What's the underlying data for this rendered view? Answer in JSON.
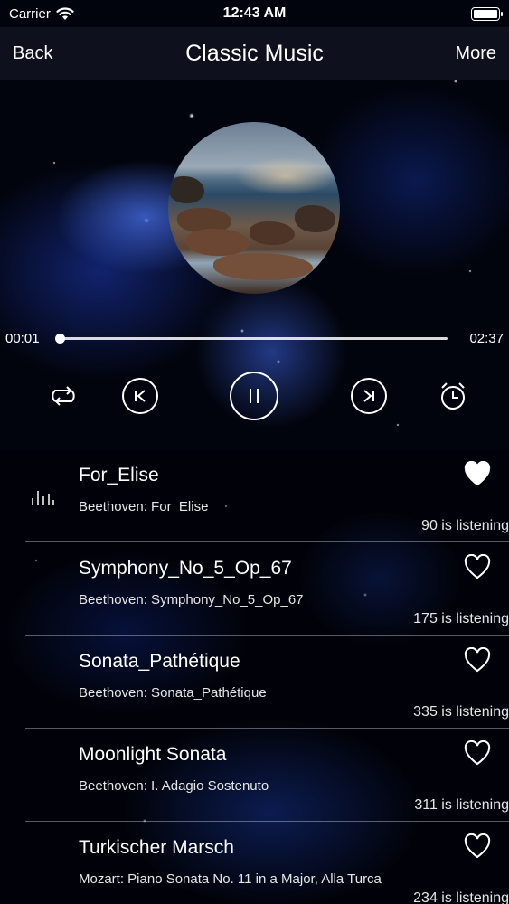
{
  "status_bar": {
    "carrier": "Carrier",
    "time": "12:43 AM",
    "battery_level": 1.0
  },
  "nav": {
    "back_label": "Back",
    "title": "Classic Music",
    "more_label": "More"
  },
  "player": {
    "elapsed": "00:01",
    "duration": "02:37",
    "progress": 0.0,
    "controls": [
      "repeat-icon",
      "previous-icon",
      "pause-icon",
      "next-icon",
      "alarm-clock-icon"
    ]
  },
  "songs": [
    {
      "title": "For_Elise",
      "subtitle": "Beethoven: For_Elise",
      "listeners": "90 is listening",
      "liked": true,
      "now_playing": true
    },
    {
      "title": "Symphony_No_5_Op_67",
      "subtitle": "Beethoven: Symphony_No_5_Op_67",
      "listeners": "175 is listening",
      "liked": false,
      "now_playing": false
    },
    {
      "title": "Sonata_Pathétique",
      "subtitle": "Beethoven: Sonata_Pathétique",
      "listeners": "335 is listening",
      "liked": false,
      "now_playing": false
    },
    {
      "title": "Moonlight Sonata",
      "subtitle": "Beethoven: I. Adagio Sostenuto",
      "listeners": "311 is listening",
      "liked": false,
      "now_playing": false
    },
    {
      "title": "Turkischer Marsch",
      "subtitle": "Mozart: Piano Sonata No. 11 in a Major, Alla Turca",
      "listeners": "234 is listening",
      "liked": false,
      "now_playing": false
    }
  ]
}
